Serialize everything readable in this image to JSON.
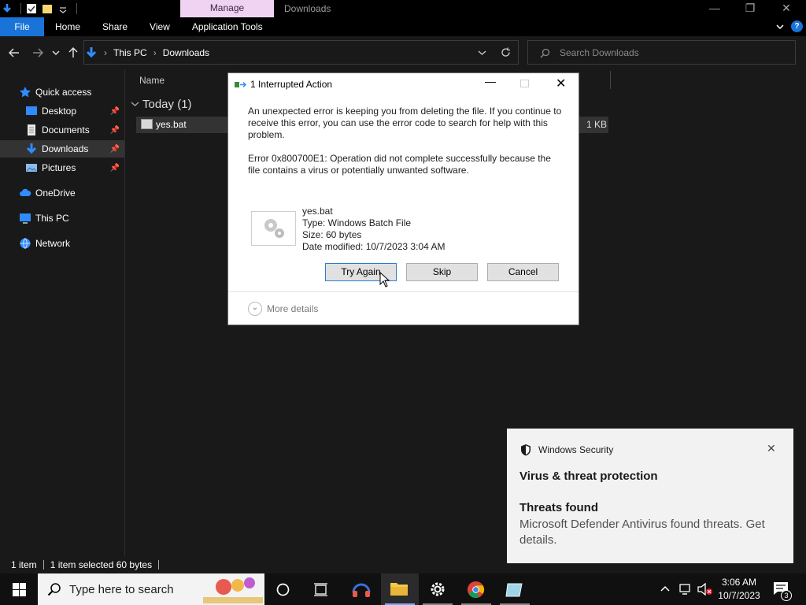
{
  "window": {
    "title": "Downloads",
    "contextual_tab": "Manage",
    "minimize": "—",
    "restore": "❐",
    "close": "✕"
  },
  "ribbon": {
    "tabs": [
      "File",
      "Home",
      "Share",
      "View",
      "Application Tools"
    ],
    "help": "?"
  },
  "address": {
    "crumbs": [
      "This PC",
      "Downloads"
    ],
    "search_placeholder": "Search Downloads"
  },
  "sidebar": {
    "items": [
      {
        "label": "Quick access"
      },
      {
        "label": "Desktop"
      },
      {
        "label": "Documents"
      },
      {
        "label": "Downloads"
      },
      {
        "label": "Pictures"
      },
      {
        "label": "OneDrive"
      },
      {
        "label": "This PC"
      },
      {
        "label": "Network"
      }
    ]
  },
  "content": {
    "column_name": "Name",
    "group_label": "Today (1)",
    "file": {
      "name": "yes.bat",
      "size": "1 KB"
    }
  },
  "status": {
    "count": "1 item",
    "selected": "1 item selected  60 bytes"
  },
  "dialog": {
    "title": "1 Interrupted Action",
    "message": "An unexpected error is keeping you from deleting the file. If you continue to receive this error, you can use the error code to search for help with this problem.",
    "error": "Error 0x800700E1: Operation did not complete successfully because the file contains a virus or potentially unwanted software.",
    "file_name": "yes.bat",
    "file_type": "Type: Windows Batch File",
    "file_size": "Size: 60 bytes",
    "file_date": "Date modified: 10/7/2023 3:04 AM",
    "btn_try": "Try Again",
    "btn_skip": "Skip",
    "btn_cancel": "Cancel",
    "more": "More details"
  },
  "toast": {
    "app": "Windows Security",
    "heading": "Virus & threat protection",
    "subheading": "Threats found",
    "body": "Microsoft Defender Antivirus found threats. Get details."
  },
  "taskbar": {
    "search_placeholder": "Type here to search",
    "time": "3:06 AM",
    "date": "10/7/2023",
    "notification_count": "3"
  },
  "colors": {
    "accent": "#1a73d8",
    "manage_tab": "#f0d2f2"
  }
}
